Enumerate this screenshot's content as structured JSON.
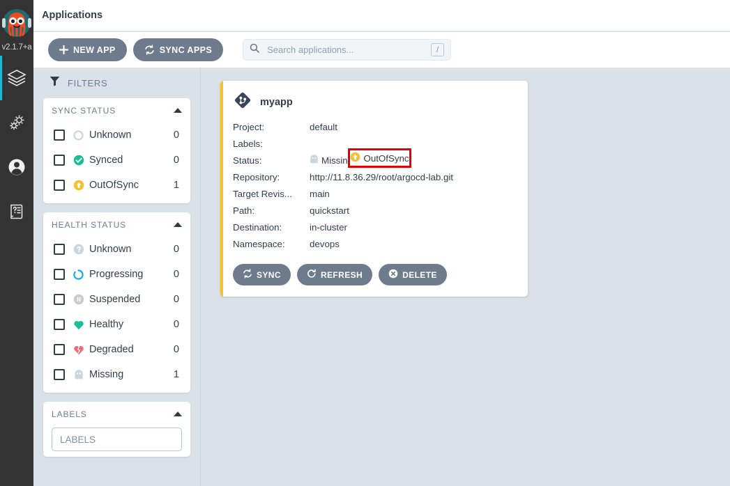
{
  "rail": {
    "logo_icon": "argo-octopus-logo",
    "version": "v2.1.7+a",
    "items": [
      {
        "name": "applications",
        "icon": "layers-icon",
        "active": true
      },
      {
        "name": "settings",
        "icon": "gears-icon",
        "active": false
      },
      {
        "name": "user-info",
        "icon": "user-circle-icon",
        "active": false
      },
      {
        "name": "documentation",
        "icon": "help-book-icon",
        "active": false
      }
    ]
  },
  "header": {
    "title": "Applications"
  },
  "toolbar": {
    "new_app_label": "NEW APP",
    "new_app_icon": "plus-icon",
    "sync_apps_label": "SYNC APPS",
    "sync_apps_icon": "sync-icon",
    "search": {
      "placeholder": "Search applications...",
      "value": "",
      "icon": "search-icon",
      "shortcut": "/"
    }
  },
  "filters": {
    "heading": "FILTERS",
    "heading_icon": "filter-funnel-icon",
    "sync_status": {
      "title": "SYNC STATUS",
      "collapse_icon": "caret-up-icon",
      "rows": [
        {
          "label": "Unknown",
          "count": "0",
          "icon": "circle-outline-icon",
          "color": "#ccd6dd",
          "checked": false
        },
        {
          "label": "Synced",
          "count": "0",
          "icon": "check-circle-icon",
          "color": "#18be94",
          "checked": false
        },
        {
          "label": "OutOfSync",
          "count": "1",
          "icon": "arrow-up-circle-icon",
          "color": "#f4c030",
          "checked": false
        }
      ]
    },
    "health_status": {
      "title": "HEALTH STATUS",
      "collapse_icon": "caret-up-icon",
      "rows": [
        {
          "label": "Unknown",
          "count": "0",
          "icon": "question-circle-icon",
          "color": "#ccd6dd",
          "checked": false
        },
        {
          "label": "Progressing",
          "count": "0",
          "icon": "progress-circle-icon",
          "color": "#0dadea",
          "checked": false
        },
        {
          "label": "Suspended",
          "count": "0",
          "icon": "pause-circle-icon",
          "color": "#c4cdd6",
          "checked": false
        },
        {
          "label": "Healthy",
          "count": "0",
          "icon": "heart-icon",
          "color": "#18be94",
          "checked": false
        },
        {
          "label": "Degraded",
          "count": "0",
          "icon": "heart-broken-icon",
          "color": "#e96d76",
          "checked": false
        },
        {
          "label": "Missing",
          "count": "1",
          "icon": "ghost-icon",
          "color": "#ccd6dd",
          "checked": false
        }
      ]
    },
    "labels": {
      "title": "LABELS",
      "collapse_icon": "caret-up-icon",
      "input_placeholder": "LABELS",
      "input_value": ""
    }
  },
  "application_card": {
    "accent_color": "#f4c030",
    "icon": "argo-app-diamond-icon",
    "name": "myapp",
    "fields": [
      {
        "key": "Project:",
        "value": "default"
      },
      {
        "key": "Labels:",
        "value": ""
      },
      {
        "key": "Repository:",
        "value": "http://11.8.36.29/root/argocd-lab.git"
      },
      {
        "key": "Target Revis...",
        "value": "main"
      },
      {
        "key": "Path:",
        "value": "quickstart"
      },
      {
        "key": "Destination:",
        "value": "in-cluster"
      },
      {
        "key": "Namespace:",
        "value": "devops"
      }
    ],
    "status_key": "Status:",
    "health_status": {
      "label": "Missing",
      "icon": "ghost-icon",
      "color": "#ccd6dd"
    },
    "sync_status": {
      "label": "OutOfSync",
      "icon": "arrow-up-circle-icon",
      "color": "#f4c030"
    },
    "annotation": {
      "highlight_color": "#e40000",
      "target": "sync-status-badge"
    },
    "actions": [
      {
        "label": "SYNC",
        "icon": "sync-icon"
      },
      {
        "label": "REFRESH",
        "icon": "refresh-icon"
      },
      {
        "label": "DELETE",
        "icon": "delete-x-circle-icon"
      }
    ]
  }
}
